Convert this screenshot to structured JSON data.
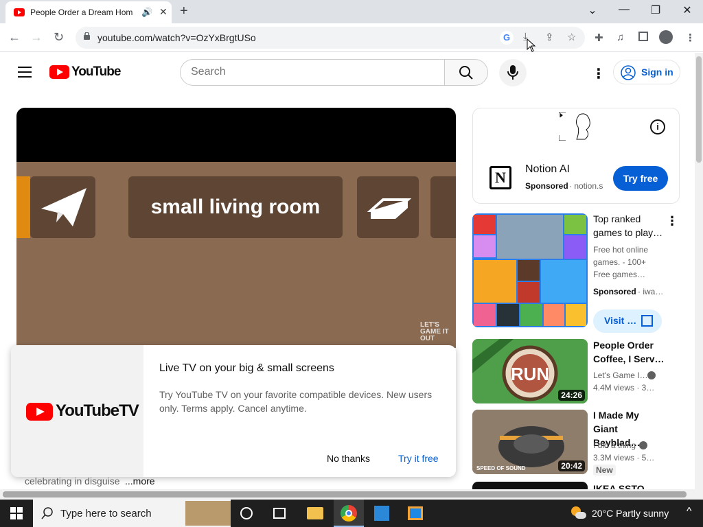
{
  "browser": {
    "tab_title": "People Order a Dream Hom",
    "url": "youtube.com/watch?v=OzYxBrgtUSo",
    "new_tab_symbol": "+",
    "window_controls": {
      "minimize": "—",
      "maximize": "❐",
      "close": "✕",
      "tab_list": "⌄"
    }
  },
  "youtube": {
    "logo_text": "YouTube",
    "search_placeholder": "Search",
    "sign_in": "Sign in"
  },
  "player": {
    "banner_text": "small living room",
    "watermark": "LET'S GAME IT OUT"
  },
  "promo": {
    "logo_text": "YouTubeTV",
    "heading": "Live TV on your big & small screens",
    "body": "Try YouTube TV on your favorite compatible devices. New users only. Terms apply. Cancel anytime.",
    "dismiss": "No thanks",
    "accept": "Try it free"
  },
  "description": {
    "text": "celebrating in disguise",
    "more": "...more"
  },
  "sidebar": {
    "ad": {
      "name": "Notion AI",
      "sponsored": "Sponsored",
      "domain": "· notion.s",
      "cta": "Try free",
      "info": "i"
    },
    "game_ad": {
      "title": "Top ranked games to play…",
      "desc": "Free hot online games. - 100+ Free games…",
      "sponsored": "Sponsored",
      "domain": "· iwa…",
      "cta": "Visit …"
    },
    "videos": [
      {
        "title": "People Order Coffee, I Serv…",
        "channel": "Let's Game I…",
        "meta": "4.4M views · 3…",
        "duration": "24:26"
      },
      {
        "title": "I Made My Giant Beyblad…",
        "channel": "I did a thing",
        "meta": "3.3M views · 5…",
        "duration": "20:42",
        "badge": "New"
      },
      {
        "title": "IKEA SSTO"
      }
    ]
  },
  "taskbar": {
    "search_placeholder": "Type here to search",
    "weather": "20°C  Partly sunny"
  },
  "colors": {
    "brand_red": "#ff0000",
    "link_blue": "#065fd4",
    "taskbar": "#1f1f1f"
  }
}
